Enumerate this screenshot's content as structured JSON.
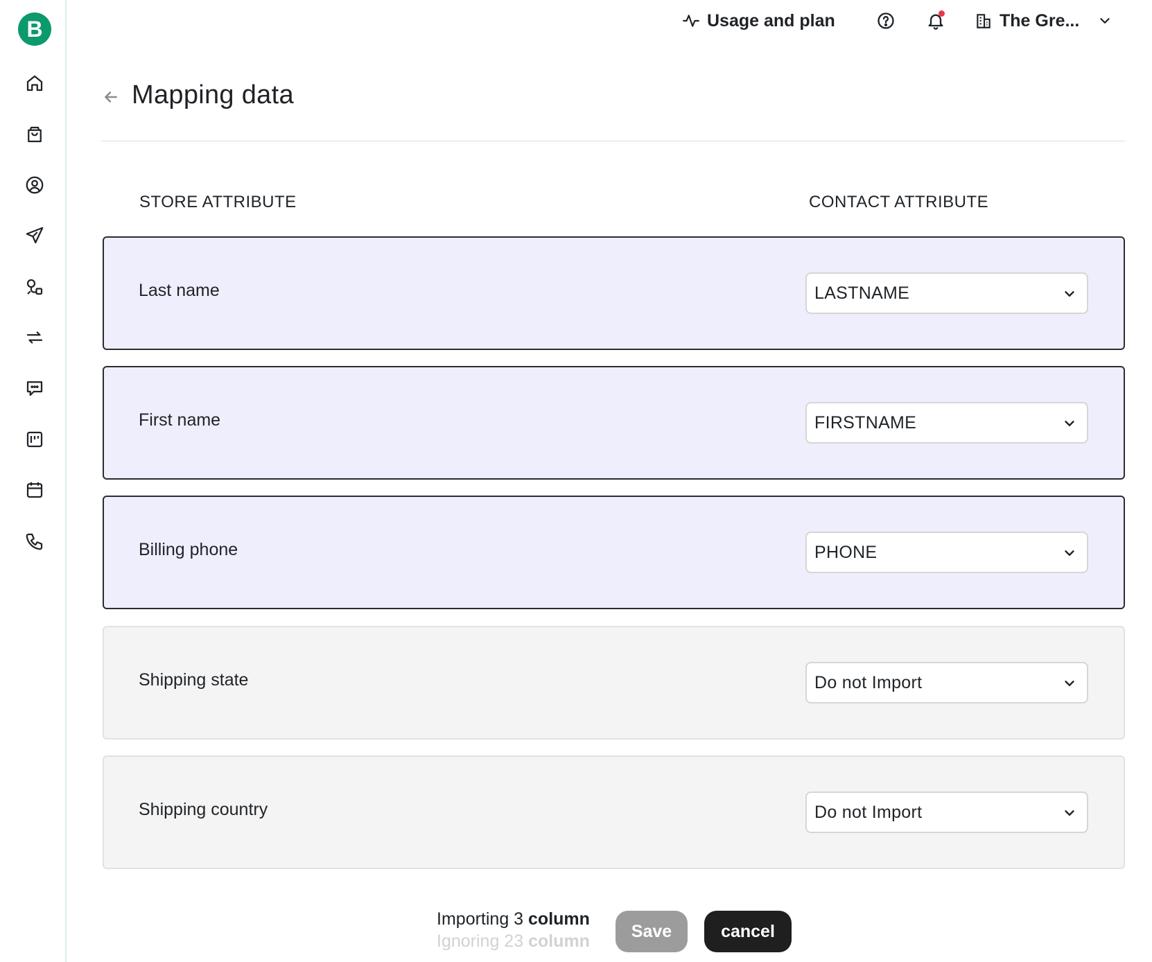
{
  "header": {
    "usage_label": "Usage and plan",
    "org_name": "The Gre...",
    "notification_dot_color": "#e8364a"
  },
  "sidebar": {
    "logo_letter": "B",
    "brand_color": "#0b996e",
    "icons": [
      "home-icon",
      "shopping-bag-icon",
      "contacts-icon",
      "send-icon",
      "automation-icon",
      "sync-icon",
      "chat-icon",
      "kanban-icon",
      "calendar-icon",
      "phone-icon"
    ]
  },
  "page": {
    "title": "Mapping data"
  },
  "table": {
    "store_header": "STORE ATTRIBUTE",
    "contact_header": "CONTACT ATTRIBUTE",
    "rows": [
      {
        "store": "Last name",
        "contact": "LASTNAME",
        "state": "active"
      },
      {
        "store": "First name",
        "contact": "FIRSTNAME",
        "state": "active"
      },
      {
        "store": "Billing phone",
        "contact": "PHONE",
        "state": "active"
      },
      {
        "store": "Shipping state",
        "contact": "Do not Import",
        "state": "inactive"
      },
      {
        "store": "Shipping country",
        "contact": "Do not Import",
        "state": "inactive"
      }
    ]
  },
  "footer": {
    "importing_prefix": "Importing 3",
    "importing_suffix": "column",
    "ignoring_prefix": "Ignoring 23",
    "ignoring_suffix": "column",
    "save_label": "Save",
    "cancel_label": "cancel"
  }
}
